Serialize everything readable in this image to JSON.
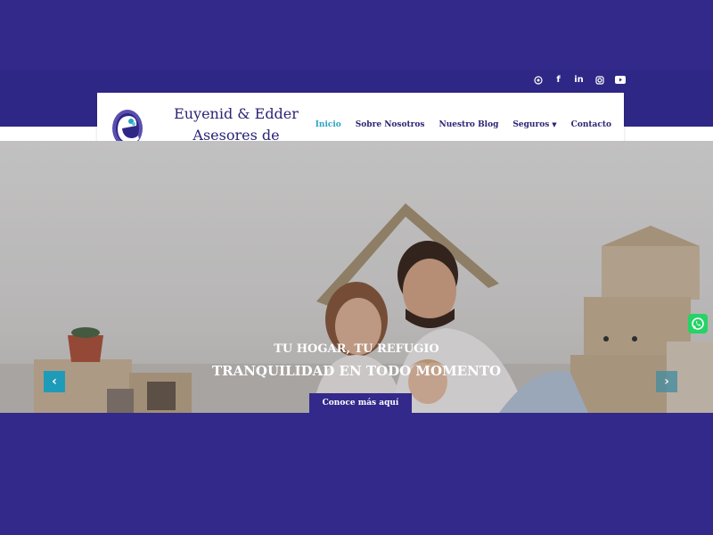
{
  "social": {
    "icons": [
      {
        "name": "whatsapp-icon",
        "glyph": "◎"
      },
      {
        "name": "facebook-icon",
        "glyph": "f"
      },
      {
        "name": "linkedin-icon",
        "glyph": "in"
      },
      {
        "name": "instagram-icon",
        "glyph": "◉"
      },
      {
        "name": "youtube-icon",
        "glyph": "▶"
      }
    ]
  },
  "brand": {
    "line1": "Euyenid & Edder",
    "line2": "Asesores de seguros"
  },
  "nav": {
    "items": [
      {
        "label": "Inicio",
        "active": true
      },
      {
        "label": "Sobre Nosotros"
      },
      {
        "label": "Nuestro Blog"
      },
      {
        "label": "Seguros",
        "dropdown": true
      },
      {
        "label": "Contacto"
      }
    ]
  },
  "hero": {
    "subtitle": "TU HOGAR, TU REFUGIO",
    "title": "TRANQUILIDAD EN TODO MOMENTO",
    "cta": "Conoce más aquí",
    "prev_icon": "chevron-left-icon",
    "next_icon": "chevron-right-icon"
  },
  "colors": {
    "primary": "#33298a",
    "accent": "#29a3c4",
    "whatsapp": "#25d366"
  }
}
